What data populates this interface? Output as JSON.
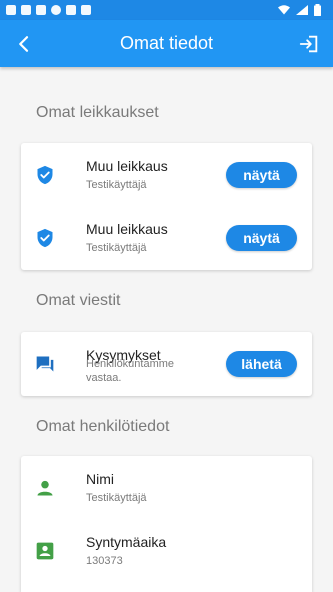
{
  "status_bar": {
    "time": "",
    "icons": [
      "gear-icon",
      "mail-icon",
      "mail-icon",
      "circle-icon",
      "sd-icon",
      "check-icon"
    ]
  },
  "app_bar": {
    "title": "Omat tiedot"
  },
  "sections": {
    "surgeries": {
      "title": "Omat leikkaukset",
      "items": [
        {
          "title": "Muu leikkaus",
          "subtitle": "Testikäyttäjä",
          "button": "näytä"
        },
        {
          "title": "Muu leikkaus",
          "subtitle": "Testikäyttäjä",
          "button": "näytä"
        }
      ]
    },
    "messages": {
      "title": "Omat viestit",
      "items": [
        {
          "title": "Kysymykset",
          "subtitle": "Henkilökuntamme vastaa.",
          "button": "lähetä"
        }
      ]
    },
    "personal": {
      "title": "Omat henkilötiedot",
      "items": [
        {
          "title": "Nimi",
          "subtitle": "Testikäyttäjä"
        },
        {
          "title": "Syntymäaika",
          "subtitle": "130373"
        }
      ]
    }
  },
  "colors": {
    "appbar": "#2196f3",
    "statusbar": "#1e88e5",
    "button": "#1e88e5",
    "shield": "#1e88e5",
    "person": "#43a047"
  }
}
